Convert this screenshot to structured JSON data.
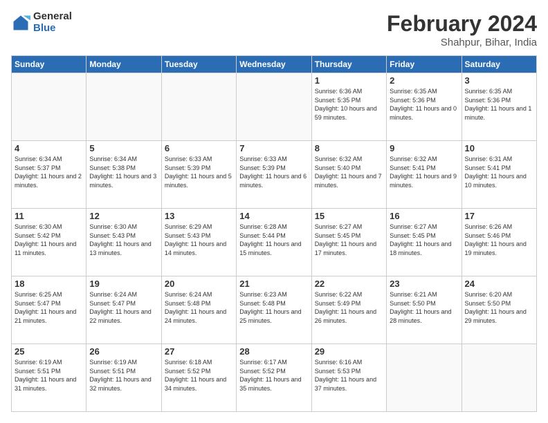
{
  "header": {
    "logo_general": "General",
    "logo_blue": "Blue",
    "title": "February 2024",
    "subtitle": "Shahpur, Bihar, India"
  },
  "days_of_week": [
    "Sunday",
    "Monday",
    "Tuesday",
    "Wednesday",
    "Thursday",
    "Friday",
    "Saturday"
  ],
  "weeks": [
    [
      {
        "day": "",
        "info": ""
      },
      {
        "day": "",
        "info": ""
      },
      {
        "day": "",
        "info": ""
      },
      {
        "day": "",
        "info": ""
      },
      {
        "day": "1",
        "info": "Sunrise: 6:36 AM\nSunset: 5:35 PM\nDaylight: 10 hours and 59 minutes."
      },
      {
        "day": "2",
        "info": "Sunrise: 6:35 AM\nSunset: 5:36 PM\nDaylight: 11 hours and 0 minutes."
      },
      {
        "day": "3",
        "info": "Sunrise: 6:35 AM\nSunset: 5:36 PM\nDaylight: 11 hours and 1 minute."
      }
    ],
    [
      {
        "day": "4",
        "info": "Sunrise: 6:34 AM\nSunset: 5:37 PM\nDaylight: 11 hours and 2 minutes."
      },
      {
        "day": "5",
        "info": "Sunrise: 6:34 AM\nSunset: 5:38 PM\nDaylight: 11 hours and 3 minutes."
      },
      {
        "day": "6",
        "info": "Sunrise: 6:33 AM\nSunset: 5:39 PM\nDaylight: 11 hours and 5 minutes."
      },
      {
        "day": "7",
        "info": "Sunrise: 6:33 AM\nSunset: 5:39 PM\nDaylight: 11 hours and 6 minutes."
      },
      {
        "day": "8",
        "info": "Sunrise: 6:32 AM\nSunset: 5:40 PM\nDaylight: 11 hours and 7 minutes."
      },
      {
        "day": "9",
        "info": "Sunrise: 6:32 AM\nSunset: 5:41 PM\nDaylight: 11 hours and 9 minutes."
      },
      {
        "day": "10",
        "info": "Sunrise: 6:31 AM\nSunset: 5:41 PM\nDaylight: 11 hours and 10 minutes."
      }
    ],
    [
      {
        "day": "11",
        "info": "Sunrise: 6:30 AM\nSunset: 5:42 PM\nDaylight: 11 hours and 11 minutes."
      },
      {
        "day": "12",
        "info": "Sunrise: 6:30 AM\nSunset: 5:43 PM\nDaylight: 11 hours and 13 minutes."
      },
      {
        "day": "13",
        "info": "Sunrise: 6:29 AM\nSunset: 5:43 PM\nDaylight: 11 hours and 14 minutes."
      },
      {
        "day": "14",
        "info": "Sunrise: 6:28 AM\nSunset: 5:44 PM\nDaylight: 11 hours and 15 minutes."
      },
      {
        "day": "15",
        "info": "Sunrise: 6:27 AM\nSunset: 5:45 PM\nDaylight: 11 hours and 17 minutes."
      },
      {
        "day": "16",
        "info": "Sunrise: 6:27 AM\nSunset: 5:45 PM\nDaylight: 11 hours and 18 minutes."
      },
      {
        "day": "17",
        "info": "Sunrise: 6:26 AM\nSunset: 5:46 PM\nDaylight: 11 hours and 19 minutes."
      }
    ],
    [
      {
        "day": "18",
        "info": "Sunrise: 6:25 AM\nSunset: 5:47 PM\nDaylight: 11 hours and 21 minutes."
      },
      {
        "day": "19",
        "info": "Sunrise: 6:24 AM\nSunset: 5:47 PM\nDaylight: 11 hours and 22 minutes."
      },
      {
        "day": "20",
        "info": "Sunrise: 6:24 AM\nSunset: 5:48 PM\nDaylight: 11 hours and 24 minutes."
      },
      {
        "day": "21",
        "info": "Sunrise: 6:23 AM\nSunset: 5:48 PM\nDaylight: 11 hours and 25 minutes."
      },
      {
        "day": "22",
        "info": "Sunrise: 6:22 AM\nSunset: 5:49 PM\nDaylight: 11 hours and 26 minutes."
      },
      {
        "day": "23",
        "info": "Sunrise: 6:21 AM\nSunset: 5:50 PM\nDaylight: 11 hours and 28 minutes."
      },
      {
        "day": "24",
        "info": "Sunrise: 6:20 AM\nSunset: 5:50 PM\nDaylight: 11 hours and 29 minutes."
      }
    ],
    [
      {
        "day": "25",
        "info": "Sunrise: 6:19 AM\nSunset: 5:51 PM\nDaylight: 11 hours and 31 minutes."
      },
      {
        "day": "26",
        "info": "Sunrise: 6:19 AM\nSunset: 5:51 PM\nDaylight: 11 hours and 32 minutes."
      },
      {
        "day": "27",
        "info": "Sunrise: 6:18 AM\nSunset: 5:52 PM\nDaylight: 11 hours and 34 minutes."
      },
      {
        "day": "28",
        "info": "Sunrise: 6:17 AM\nSunset: 5:52 PM\nDaylight: 11 hours and 35 minutes."
      },
      {
        "day": "29",
        "info": "Sunrise: 6:16 AM\nSunset: 5:53 PM\nDaylight: 11 hours and 37 minutes."
      },
      {
        "day": "",
        "info": ""
      },
      {
        "day": "",
        "info": ""
      }
    ]
  ]
}
